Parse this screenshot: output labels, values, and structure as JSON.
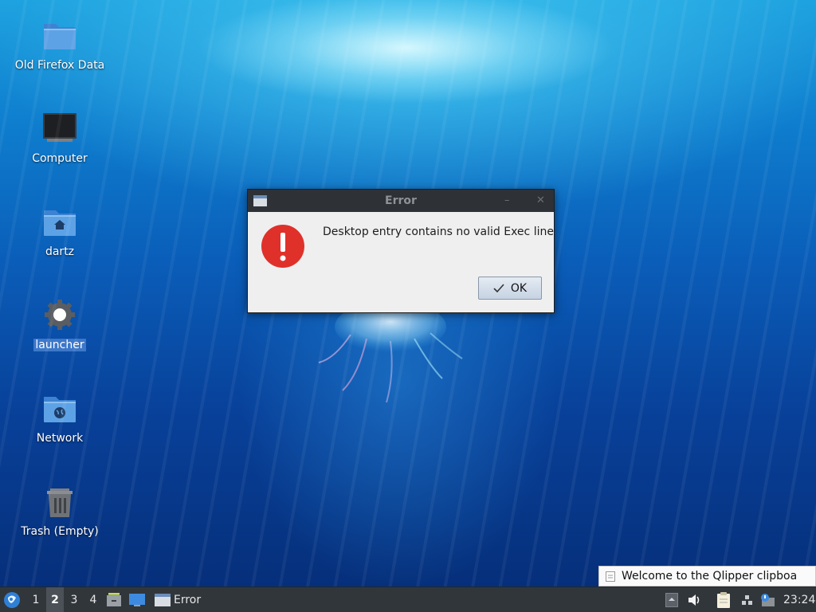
{
  "desktop": {
    "icons": [
      {
        "label": "Old Firefox Data",
        "icon": "folder-icon"
      },
      {
        "label": "Computer",
        "icon": "computer-icon"
      },
      {
        "label": "dartz",
        "icon": "home-folder-icon"
      },
      {
        "label": "launcher",
        "icon": "gear-icon",
        "selected": true
      },
      {
        "label": "Network",
        "icon": "network-folder-icon"
      },
      {
        "label": "Trash (Empty)",
        "icon": "trash-icon"
      }
    ]
  },
  "dialog": {
    "title": "Error",
    "message": "Desktop entry contains no valid Exec line",
    "ok_label": "OK",
    "minimize_glyph": "–",
    "close_glyph": "✕"
  },
  "notification": {
    "text": "Welcome to the Qlipper clipboa"
  },
  "panel": {
    "workspaces": [
      "1",
      "2",
      "3",
      "4"
    ],
    "active_workspace": "2",
    "task_label": "Error",
    "clock": "23:24"
  },
  "colors": {
    "panel_bg": "#31363b",
    "titlebar_bg": "#2e3236",
    "error_red": "#e0302a",
    "selection": "#3c77c9"
  }
}
